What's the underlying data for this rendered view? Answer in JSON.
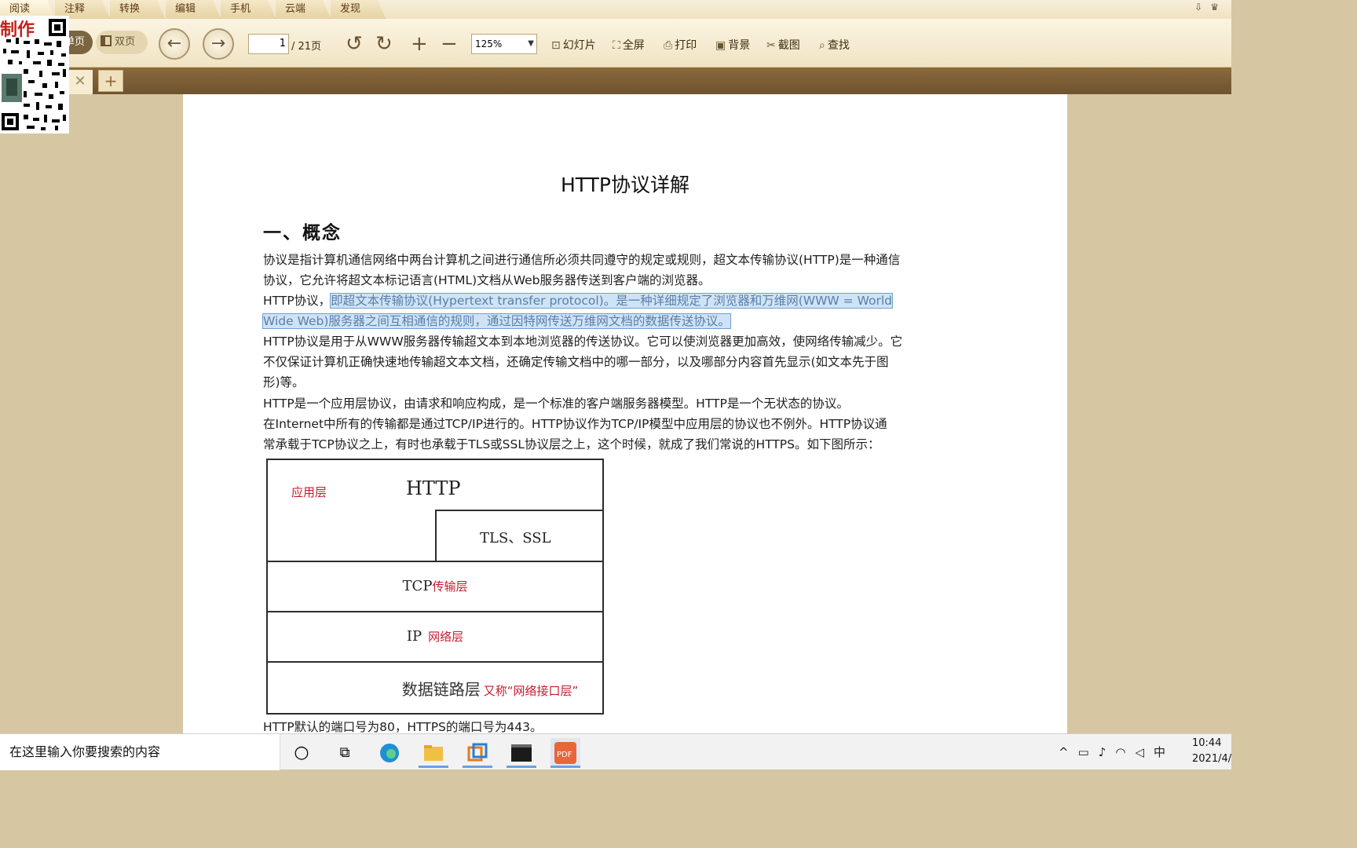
{
  "menu": [
    "阅读",
    "注释",
    "转换",
    "编辑",
    "手机",
    "云端",
    "发现"
  ],
  "toolbar": {
    "single_page": "单页",
    "double_page": "双页",
    "page_current": "1",
    "page_total": "/ 21页",
    "zoom": "125%",
    "slideshow": "幻灯片",
    "fullscreen": "全屏",
    "print": "打印",
    "background": "背景",
    "screenshot": "截图",
    "find": "查找"
  },
  "qr_watermark": "制作",
  "document": {
    "title": "HTTP协议详解",
    "section": "一、概念",
    "p1": "协议是指计算机通信网络中两台计算机之间进行通信所必须共同遵守的规定或规则，超文本传输协议(HTTP)是一种通信",
    "p1b": "协议，它允许将超文本标记语言(HTML)文档从Web服务器传送到客户端的浏览器。",
    "p2_lead": "HTTP协议，",
    "p2_hl1": "即超文本传输协议(Hypertext transfer protocol)。是一种详细规定了浏览器和万维网(WWW = World",
    "p2_hl2": "Wide Web)服务器之间互相通信的规则，通过因特网传送万维网文档的数据传送协议。",
    "p3a": "HTTP协议是用于从WWW服务器传输超文本到本地浏览器的传送协议。它可以使浏览器更加高效，使网络传输减少。它",
    "p3b": "不仅保证计算机正确快速地传输超文本文档，还确定传输文档中的哪一部分，以及哪部分内容首先显示(如文本先于图",
    "p3c": "形)等。",
    "p4": "HTTP是一个应用层协议，由请求和响应构成，是一个标准的客户端服务器模型。HTTP是一个无状态的协议。",
    "p5a": "在Internet中所有的传输都是通过TCP/IP进行的。HTTP协议作为TCP/IP模型中应用层的协议也不例外。HTTP协议通",
    "p5b": "常承载于TCP协议之上，有时也承载于TLS或SSL协议层之上，这个时候，就成了我们常说的HTTPS。如下图所示：",
    "diagram": {
      "app_layer_zh": "应用层",
      "http": "HTTP",
      "tls": "TLS、SSL",
      "tcp": "TCP",
      "tcp_zh": "传输层",
      "ip": "IP",
      "ip_zh": "网络层",
      "link_zh": "数据链路层",
      "link_alias": "又称“网络接口层”"
    },
    "port_line": "HTTP默认的端口号为80，HTTPS的端口号为443。"
  },
  "taskbar": {
    "search_placeholder": "在这里输入你要搜索的内容",
    "ime": "中",
    "time": "10:44",
    "date": "2021/4/"
  }
}
